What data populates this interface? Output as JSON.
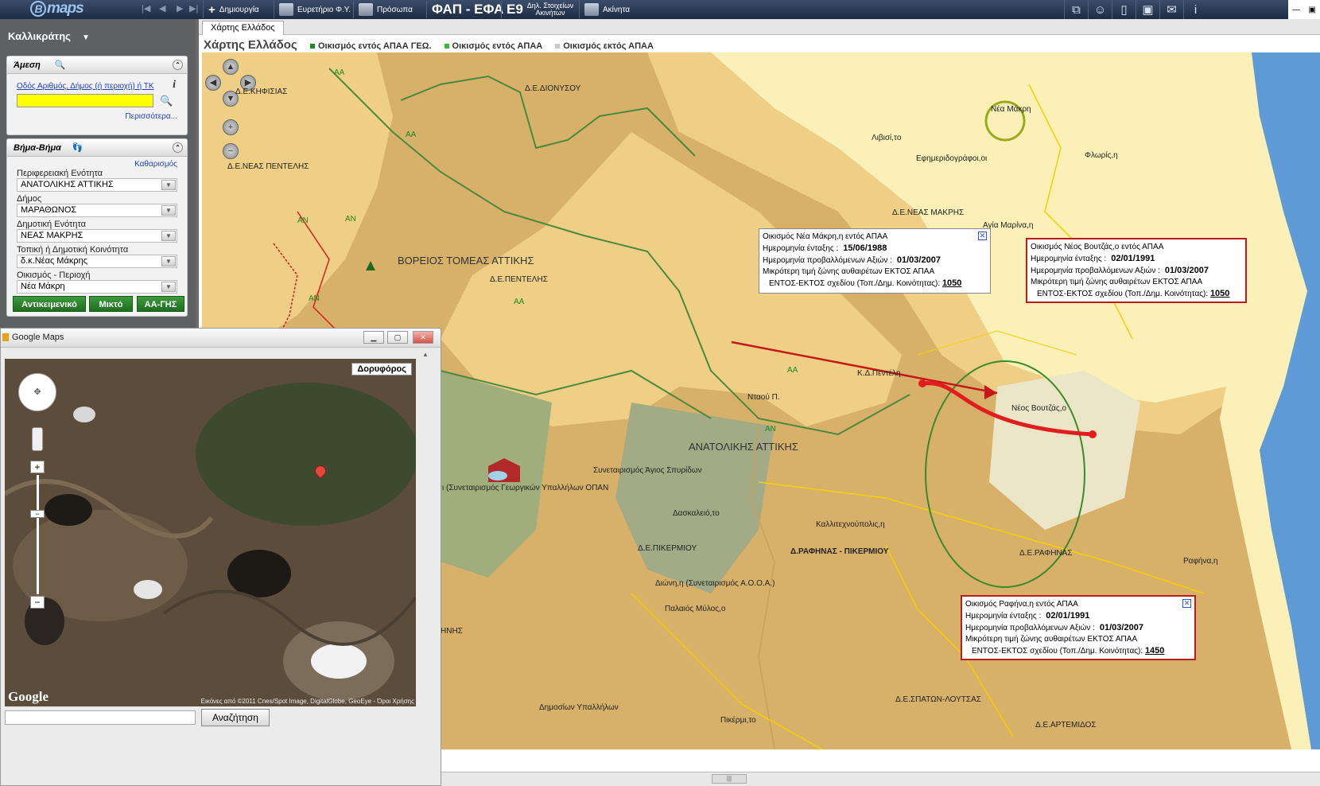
{
  "app": {
    "logo": "maps",
    "logo_letter": "B"
  },
  "toolbar": {
    "create": "Δημιουργία",
    "index": "Ευρετήριο Φ.Υ.",
    "persons": "Πρόσωπα",
    "fap": "ΦΑΠ - ΕΦΑ",
    "e9_num": "Ε9",
    "e9_line1": "Δηλ. Στοιχείων",
    "e9_line2": "Ακινήτων",
    "properties": "Ακίνητα"
  },
  "sidebar": {
    "region": "Καλλικράτης",
    "direct": {
      "title": "Άμεση",
      "link": "Οδός Αριθμός, Δήμος (ή περιοχή) ή ΤΚ",
      "more": "Περισσότερα..."
    },
    "step": {
      "title": "Βήμα-Βήμα",
      "clear": "Καθαρισμός",
      "fields": [
        {
          "label": "Περιφερειακή Ενότητα",
          "value": "ΑΝΑΤΟΛΙΚΗΣ ΑΤΤΙΚΗΣ"
        },
        {
          "label": "Δήμος",
          "value": "ΜΑΡΑΘΩΝΟΣ"
        },
        {
          "label": "Δημοτική Ενότητα",
          "value": "ΝΕΑΣ ΜΑΚΡΗΣ"
        },
        {
          "label": "Τοπική ή Δημοτική Κοινότητα",
          "value": "δ.κ.Νέας Μάκρης"
        },
        {
          "label": "Οικισμός - Περιοχή",
          "value": "Νέα Μάκρη"
        }
      ],
      "buttons": [
        "Αντικειμενικό",
        "Μικτό",
        "ΑΑ-ΓΗΣ"
      ]
    }
  },
  "map": {
    "tab": "Χάρτης Ελλάδος",
    "title": "Χάρτης Ελλάδος",
    "legend": [
      "Οικισμός εντός ΑΠΑΑ ΓΕΩ.",
      "Οικισμός εντός ΑΠΑΑ",
      "Οικισμός εκτός ΑΠΑΑ"
    ],
    "colors": {
      "dark": "#d7b16a",
      "mid": "#efcf86",
      "light": "#faf0b8",
      "sea": "#5e9bd6",
      "roads": "#f5d000",
      "green": "#4a8a3c"
    },
    "labels": {
      "kifisia": "Δ.Ε.ΚΗΦΙΣΙΑΣ",
      "dionysos": "Δ.Ε.ΔΙΟΝΥΣΟΥ",
      "neapenteli": "Δ.Ε.ΝΕΑΣ ΠΕΝΤΕΛΗΣ",
      "voreios": "ΒΟΡΕΙΟΣ ΤΟΜΕΑΣ ΑΤΤΙΚΗΣ",
      "penteli": "Δ.Ε.ΠΕΝΤΕΛΗΣ",
      "anatolikis": "ΑΝΑΤΟΛΙΚΗΣ ΑΤΤΙΚΗΣ",
      "neamakri": "Δ.Ε.ΝΕΑΣ ΜΑΚΡΗΣ",
      "nea_makri_town": "Νέα Μάκρη",
      "livisi": "Λιβισί,το",
      "efimeridografoi": "Εφημεριδογράφοι,οι",
      "flogita": "Φλωρίς,η",
      "agia_marina": "Αγία Μαρίνα,η",
      "kd_penteli": "Κ.Δ.Πεντέλη",
      "neos_voutzas": "Νέος Βουτζάς,ο",
      "synet_spyridon": "Συνεταιρισμός Άγιος Σπυρίδων",
      "synet_opan": "ι (Συνεταιρισμός Γεωργικών Υπαλλήλων ΟΠΑΝ",
      "daskalio": "Δασκαλειό,το",
      "pikermiou": "Δ.Ε.ΠΙΚΕΡΜΙΟΥ",
      "rafina_pikermi": "Δ.ΡΑΦΗΝΑΣ - ΠΙΚΕΡΜΙΟΥ",
      "kallitexnoupoli": "Καλλιτεχνούπολις,η",
      "rafinas": "Δ.Ε.ΡΑΦΗΝΑΣ",
      "rafina": "Ραφήνα,η",
      "dioni": "Διώνη,η (Συνεταιρισμός Α.Ο.Ο.Α.)",
      "palaios_mylos": "Παλαιός Μύλος,ο",
      "dimosion": "Δημοσίων Υπαλλήλων",
      "pikermi": "Πικέρμι,το",
      "spaton": "Δ.Ε.ΣΠΑΤΩΝ-ΛΟΥΤΣΑΣ",
      "artemidos": "Δ.Ε.ΑΡΤΕΜΙΔΟΣ",
      "nis": "ΗΝΗΣ",
      "ntaou": "Νταού Π.",
      "aa": "ΑΑ",
      "an": "ΑΝ"
    },
    "popups": [
      {
        "title": "Οικισμός Νέα Μάκρη,η εντός ΑΠΑΑ",
        "l1": "Ημερομηνία ένταξης :",
        "v1": "15/06/1988",
        "l2": "Ημερομηνία προβαλλόμενων Αξιών :",
        "v2": "01/03/2007",
        "l3": "Μικρότερη τιμή ζώνης αυθαιρέτων ΕΚΤΟΣ ΑΠΑΑ",
        "l4": "ΕΝΤΟΣ-ΕΚΤΟΣ σχεδίου (Τοπ./Δημ. Κοινότητας):",
        "v4": "1050"
      },
      {
        "title": "Οικισμός Νέος Βουτζάς,ο εντός ΑΠΑΑ",
        "l1": "Ημερομηνία ένταξης :",
        "v1": "02/01/1991",
        "l2": "Ημερομηνία προβαλλόμενων Αξιών :",
        "v2": "01/03/2007",
        "l3": "Μικρότερη τιμή ζώνης αυθαιρέτων ΕΚΤΟΣ ΑΠΑΑ",
        "l4": "ΕΝΤΟΣ-ΕΚΤΟΣ σχεδίου (Τοπ./Δημ. Κοινότητας):",
        "v4": "1050"
      },
      {
        "title": "Οικισμός Ραφήνα,η εντός ΑΠΑΑ",
        "l1": "Ημερομηνία ένταξης :",
        "v1": "02/01/1991",
        "l2": "Ημερομηνία προβαλλόμενων Αξιών :",
        "v2": "01/03/2007",
        "l3": "Μικρότερη τιμή ζώνης αυθαιρέτων ΕΚΤΟΣ ΑΠΑΑ",
        "l4": "ΕΝΤΟΣ-ΕΚΤΟΣ σχεδίου (Τοπ./Δημ. Κοινότητας):",
        "v4": "1450"
      }
    ]
  },
  "gmaps": {
    "title": "Google Maps",
    "satellite": "Δορυφόρος",
    "copyright": "Εικόνες από ©2011 Cnes/Spot Image, DigitalGlobe, GeoEye - Όροι Χρήσης",
    "logo": "Google",
    "search_btn": "Αναζήτηση"
  }
}
